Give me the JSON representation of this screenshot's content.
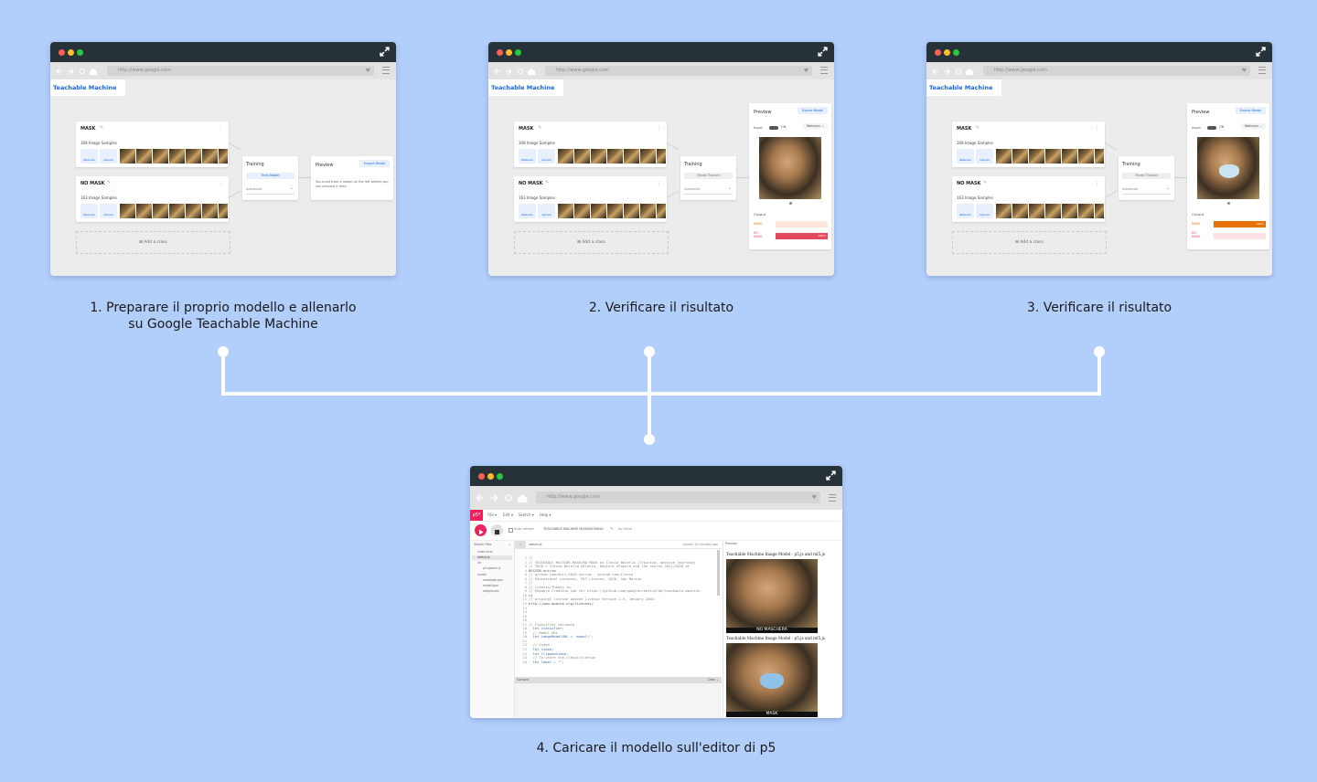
{
  "browser": {
    "url": "http://www.google.com"
  },
  "teachable": {
    "app_tag": "Teachable Machine",
    "classes": [
      {
        "name": "MASK",
        "samples": "308 Image Samples"
      },
      {
        "name": "NO MASK",
        "samples": "163 Image Samples"
      }
    ],
    "webcam_label": "Webcam",
    "upload_label": "Upload",
    "add_class": "Add a class",
    "training_title": "Training",
    "train_button": "Train Model",
    "trained_button": "Model Trained",
    "advanced": "Advanced",
    "preview_title": "Preview",
    "export_button": "Export Model",
    "preview_hint": "You must train a model on the left before you can preview it here.",
    "input_label": "Input",
    "input_on": "ON",
    "input_source": "Webcam",
    "output_label": "Output",
    "output_classes": [
      "MASK",
      "NO MASK"
    ],
    "result_step2": {
      "mask": 0,
      "no_mask": 100,
      "label": "100%"
    },
    "result_step3": {
      "mask": 100,
      "no_mask": 0,
      "label": "100%"
    },
    "colors": {
      "mask_bar": "#e8710a",
      "no_mask_bar": "#e3485f",
      "empty_mask": "#fde7dc",
      "empty_nomask": "#fce4e6"
    }
  },
  "p5": {
    "logo": "p5*",
    "menu": [
      "File",
      "Edit",
      "Sketch",
      "Help"
    ],
    "auto_refresh": "Auto-refresh",
    "project": "TEACHABLE MACHINE MASK/NOMASK",
    "author": "by ilenia",
    "sketch_files": "Sketch Files",
    "file_tab": "sketch.js",
    "saved": "Saved: 10 minutes ago",
    "preview": "Preview",
    "files": [
      "index.html",
      "sketch.js",
      "lib",
      "p5.speech.js",
      "model",
      "metadata.json",
      "model.json",
      "weights.bin"
    ],
    "console": "Console",
    "clear": "Clear",
    "code_lines": [
      "//",
      "// TEACHABLE MACHINE-MASK/NO MASK by Ilenia Balella [Training, machine learning]",
      "// 2020 © Ilenia Balella @Ilenia, Daniele @Tapera and the course 2021/2020 at",
      "DESIGN.unirsm",
      "// github.com/dsii-2020-unirsm - github.com/ilenia",
      "// Educational purposes, MIT License, 2020, San Marino",
      "//",
      "// Credits/Thanks to:",
      "// @Google Creative Lab for https://github.com/googlecreativelab/teachable-machine-",
      "v1",
      "// original license Apache License Version 2.0, January 2004",
      "http://www.apache.org/licenses/",
      "",
      "",
      "",
      "",
      "// Classifier Variable",
      "  let classifier;",
      "  // Model URL",
      "  let imageModelURL = 'model/';",
      "",
      "  // Video",
      "  let video;",
      "  let flippedVideo;",
      "  // To store the classification",
      "  let label = \"\";"
    ],
    "preview_caption": "Teachable Machine Image Model - p5.js and ml5.js",
    "labels": [
      "NO MASCHERA",
      "MASK"
    ]
  },
  "captions": {
    "step1_line1": "1. Preparare il proprio modello e allenarlo",
    "step1_line2": "su Google Teachable Machine",
    "step2": "2. Verificare il risultato",
    "step3": "3. Verificare il risultato",
    "step4": "4. Caricare il modello sull'editor di p5"
  }
}
